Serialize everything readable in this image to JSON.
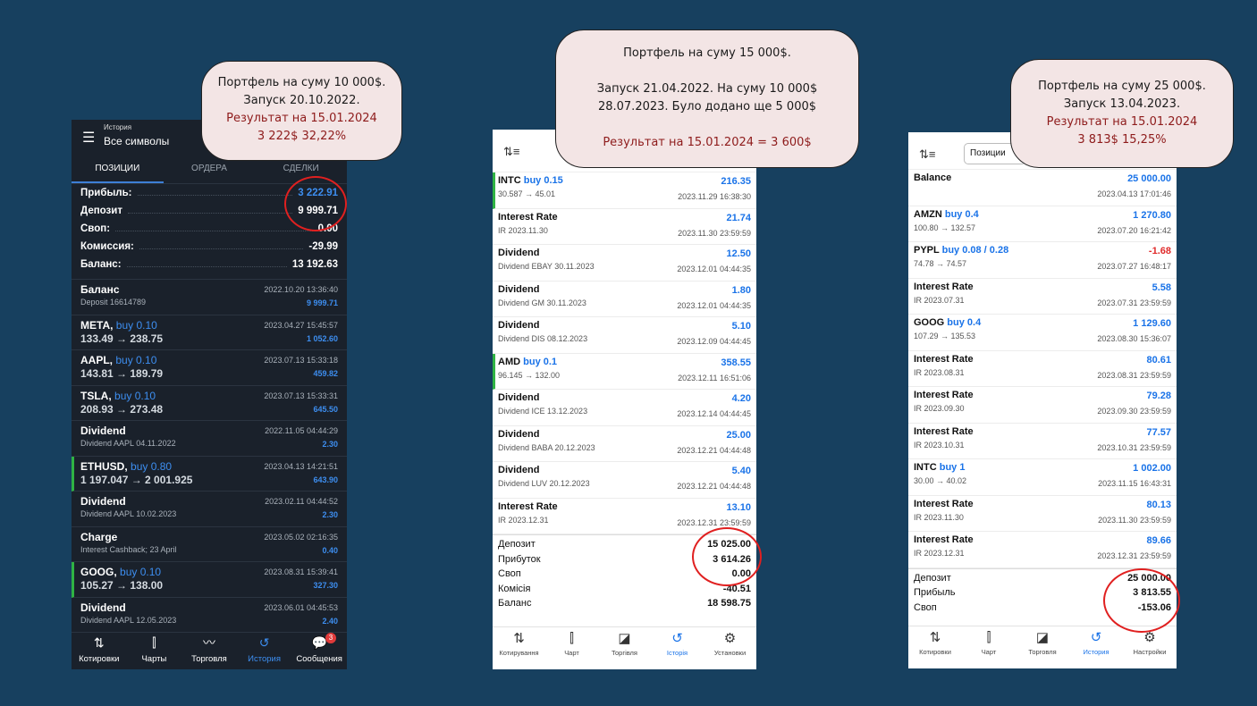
{
  "phone1": {
    "header_title": "История",
    "header_sub": "Все символы",
    "tabs": [
      "ПОЗИЦИИ",
      "ОРДЕРА",
      "СДЕЛКИ"
    ],
    "summary": [
      {
        "label": "Прибыль:",
        "value": "3 222.91"
      },
      {
        "label": "Депозит",
        "value": "9 999.71"
      },
      {
        "label": "Своп:",
        "value": "0.00"
      },
      {
        "label": "Комиссия:",
        "value": "-29.99"
      },
      {
        "label": "Баланс:",
        "value": "13 192.63"
      }
    ],
    "rows": [
      {
        "title": "Баланс",
        "buy": "",
        "sub": "Deposit 16614789",
        "date": "2022.10.20 13:36:40",
        "value": "9 999.71"
      },
      {
        "title": "META,",
        "buy": "buy 0.10",
        "sub": "133.49 → 238.75",
        "date": "2023.04.27 15:45:57",
        "value": "1 052.60"
      },
      {
        "title": "AAPL,",
        "buy": "buy 0.10",
        "sub": "143.81 → 189.79",
        "date": "2023.07.13 15:33:18",
        "value": "459.82"
      },
      {
        "title": "TSLA,",
        "buy": "buy 0.10",
        "sub": "208.93 → 273.48",
        "date": "2023.07.13 15:33:31",
        "value": "645.50"
      },
      {
        "title": "Dividend",
        "buy": "",
        "sub": "Dividend AAPL 04.11.2022",
        "date": "2022.11.05 04:44:29",
        "value": "2.30"
      },
      {
        "title": "ETHUSD,",
        "buy": "buy 0.80",
        "sub": "1 197.047 → 2 001.925",
        "date": "2023.04.13 14:21:51",
        "value": "643.90"
      },
      {
        "title": "Dividend",
        "buy": "",
        "sub": "Dividend AAPL 10.02.2023",
        "date": "2023.02.11 04:44:52",
        "value": "2.30"
      },
      {
        "title": "Charge",
        "buy": "",
        "sub": "Interest Cashback; 23 April",
        "date": "2023.05.02 02:16:35",
        "value": "0.40"
      },
      {
        "title": "GOOG,",
        "buy": "buy 0.10",
        "sub": "105.27 → 138.00",
        "date": "2023.08.31 15:39:41",
        "value": "327.30"
      },
      {
        "title": "Dividend",
        "buy": "",
        "sub": "Dividend AAPL 12.05.2023",
        "date": "2023.06.01 04:45:53",
        "value": "2.40"
      }
    ],
    "nav": [
      "Котировки",
      "Чарты",
      "Торговля",
      "История",
      "Сообщения"
    ],
    "badge": "3"
  },
  "phone2": {
    "rows": [
      {
        "title": "INTC",
        "buy": "buy 0.15",
        "sub": "30.587 → 45.01",
        "date": "2023.11.29 16:38:30",
        "value": "216.35"
      },
      {
        "title": "Interest Rate",
        "buy": "",
        "sub": "IR 2023.11.30",
        "date": "2023.11.30 23:59:59",
        "value": "21.74"
      },
      {
        "title": "Dividend",
        "buy": "",
        "sub": "Dividend EBAY 30.11.2023",
        "date": "2023.12.01 04:44:35",
        "value": "12.50"
      },
      {
        "title": "Dividend",
        "buy": "",
        "sub": "Dividend GM 30.11.2023",
        "date": "2023.12.01 04:44:35",
        "value": "1.80"
      },
      {
        "title": "Dividend",
        "buy": "",
        "sub": "Dividend DIS 08.12.2023",
        "date": "2023.12.09 04:44:45",
        "value": "5.10"
      },
      {
        "title": "AMD",
        "buy": "buy 0.1",
        "sub": "96.145 → 132.00",
        "date": "2023.12.11 16:51:06",
        "value": "358.55"
      },
      {
        "title": "Dividend",
        "buy": "",
        "sub": "Dividend ICE 13.12.2023",
        "date": "2023.12.14 04:44:45",
        "value": "4.20"
      },
      {
        "title": "Dividend",
        "buy": "",
        "sub": "Dividend BABA 20.12.2023",
        "date": "2023.12.21 04:44:48",
        "value": "25.00"
      },
      {
        "title": "Dividend",
        "buy": "",
        "sub": "Dividend LUV 20.12.2023",
        "date": "2023.12.21 04:44:48",
        "value": "5.40"
      },
      {
        "title": "Interest Rate",
        "buy": "",
        "sub": "IR 2023.12.31",
        "date": "2023.12.31 23:59:59",
        "value": "13.10"
      }
    ],
    "footer": [
      {
        "label": "Депозит",
        "value": "15 025.00"
      },
      {
        "label": "Прибуток",
        "value": "3 614.26"
      },
      {
        "label": "Своп",
        "value": "0.00"
      },
      {
        "label": "Комісія",
        "value": "-40.51"
      },
      {
        "label": "Баланс",
        "value": "18 598.75"
      }
    ],
    "nav": [
      "Котирування",
      "Чарт",
      "Торгівля",
      "Історія",
      "Установки"
    ]
  },
  "phone3": {
    "segment": "Позиции",
    "rows": [
      {
        "title": "Balance",
        "buy": "",
        "sub": "",
        "date": "2023.04.13 17:01:46",
        "value": "25 000.00",
        "neg": false
      },
      {
        "title": "AMZN",
        "buy": "buy 0.4",
        "sub": "100.80 → 132.57",
        "date": "2023.07.20 16:21:42",
        "value": "1 270.80",
        "neg": false
      },
      {
        "title": "PYPL",
        "buy": "buy 0.08 / 0.28",
        "sub": "74.78 → 74.57",
        "date": "2023.07.27 16:48:17",
        "value": "-1.68",
        "neg": true
      },
      {
        "title": "Interest Rate",
        "buy": "",
        "sub": "IR 2023.07.31",
        "date": "2023.07.31 23:59:59",
        "value": "5.58",
        "neg": false
      },
      {
        "title": "GOOG",
        "buy": "buy 0.4",
        "sub": "107.29 → 135.53",
        "date": "2023.08.30 15:36:07",
        "value": "1 129.60",
        "neg": false
      },
      {
        "title": "Interest Rate",
        "buy": "",
        "sub": "IR 2023.08.31",
        "date": "2023.08.31 23:59:59",
        "value": "80.61",
        "neg": false
      },
      {
        "title": "Interest Rate",
        "buy": "",
        "sub": "IR 2023.09.30",
        "date": "2023.09.30 23:59:59",
        "value": "79.28",
        "neg": false
      },
      {
        "title": "Interest Rate",
        "buy": "",
        "sub": "IR 2023.10.31",
        "date": "2023.10.31 23:59:59",
        "value": "77.57",
        "neg": false
      },
      {
        "title": "INTC",
        "buy": "buy 1",
        "sub": "30.00 → 40.02",
        "date": "2023.11.15 16:43:31",
        "value": "1 002.00",
        "neg": false
      },
      {
        "title": "Interest Rate",
        "buy": "",
        "sub": "IR 2023.11.30",
        "date": "2023.11.30 23:59:59",
        "value": "80.13",
        "neg": false
      },
      {
        "title": "Interest Rate",
        "buy": "",
        "sub": "IR 2023.12.31",
        "date": "2023.12.31 23:59:59",
        "value": "89.66",
        "neg": false
      }
    ],
    "footer": [
      {
        "label": "Депозит",
        "value": "25 000.00"
      },
      {
        "label": "Прибыль",
        "value": "3 813.55"
      },
      {
        "label": "Своп",
        "value": "-153.06"
      }
    ],
    "nav": [
      "Котировки",
      "Чарт",
      "Торговля",
      "История",
      "Настройки"
    ]
  },
  "callouts": {
    "c1": {
      "l1": "Портфель на суму 10 000$.",
      "l2": "Запуск 20.10.2022.",
      "l3": "Результат на 15.01.2024",
      "l4": "3 222$  32,22%"
    },
    "c2": {
      "l1": "Портфель на суму 15 000$.",
      "l2": "Запуск 21.04.2022.  На суму 10 000$",
      "l3": "28.07.2023. Було додано ще 5 000$",
      "l4": "Результат на 15.01.2024  = 3 600$"
    },
    "c3": {
      "l1": "Портфель на суму 25 000$.",
      "l2": "Запуск 13.04.2023.",
      "l3": "Результат на 15.01.2024",
      "l4": "3 813$  15,25%"
    }
  },
  "colors": {
    "background": "#17405f",
    "accent_blue": "#1a73e8",
    "highlight_red": "#e02020",
    "callout_bg": "#f3e5e5",
    "result_text": "#8e1b1b",
    "negative": "#e02b2b"
  }
}
